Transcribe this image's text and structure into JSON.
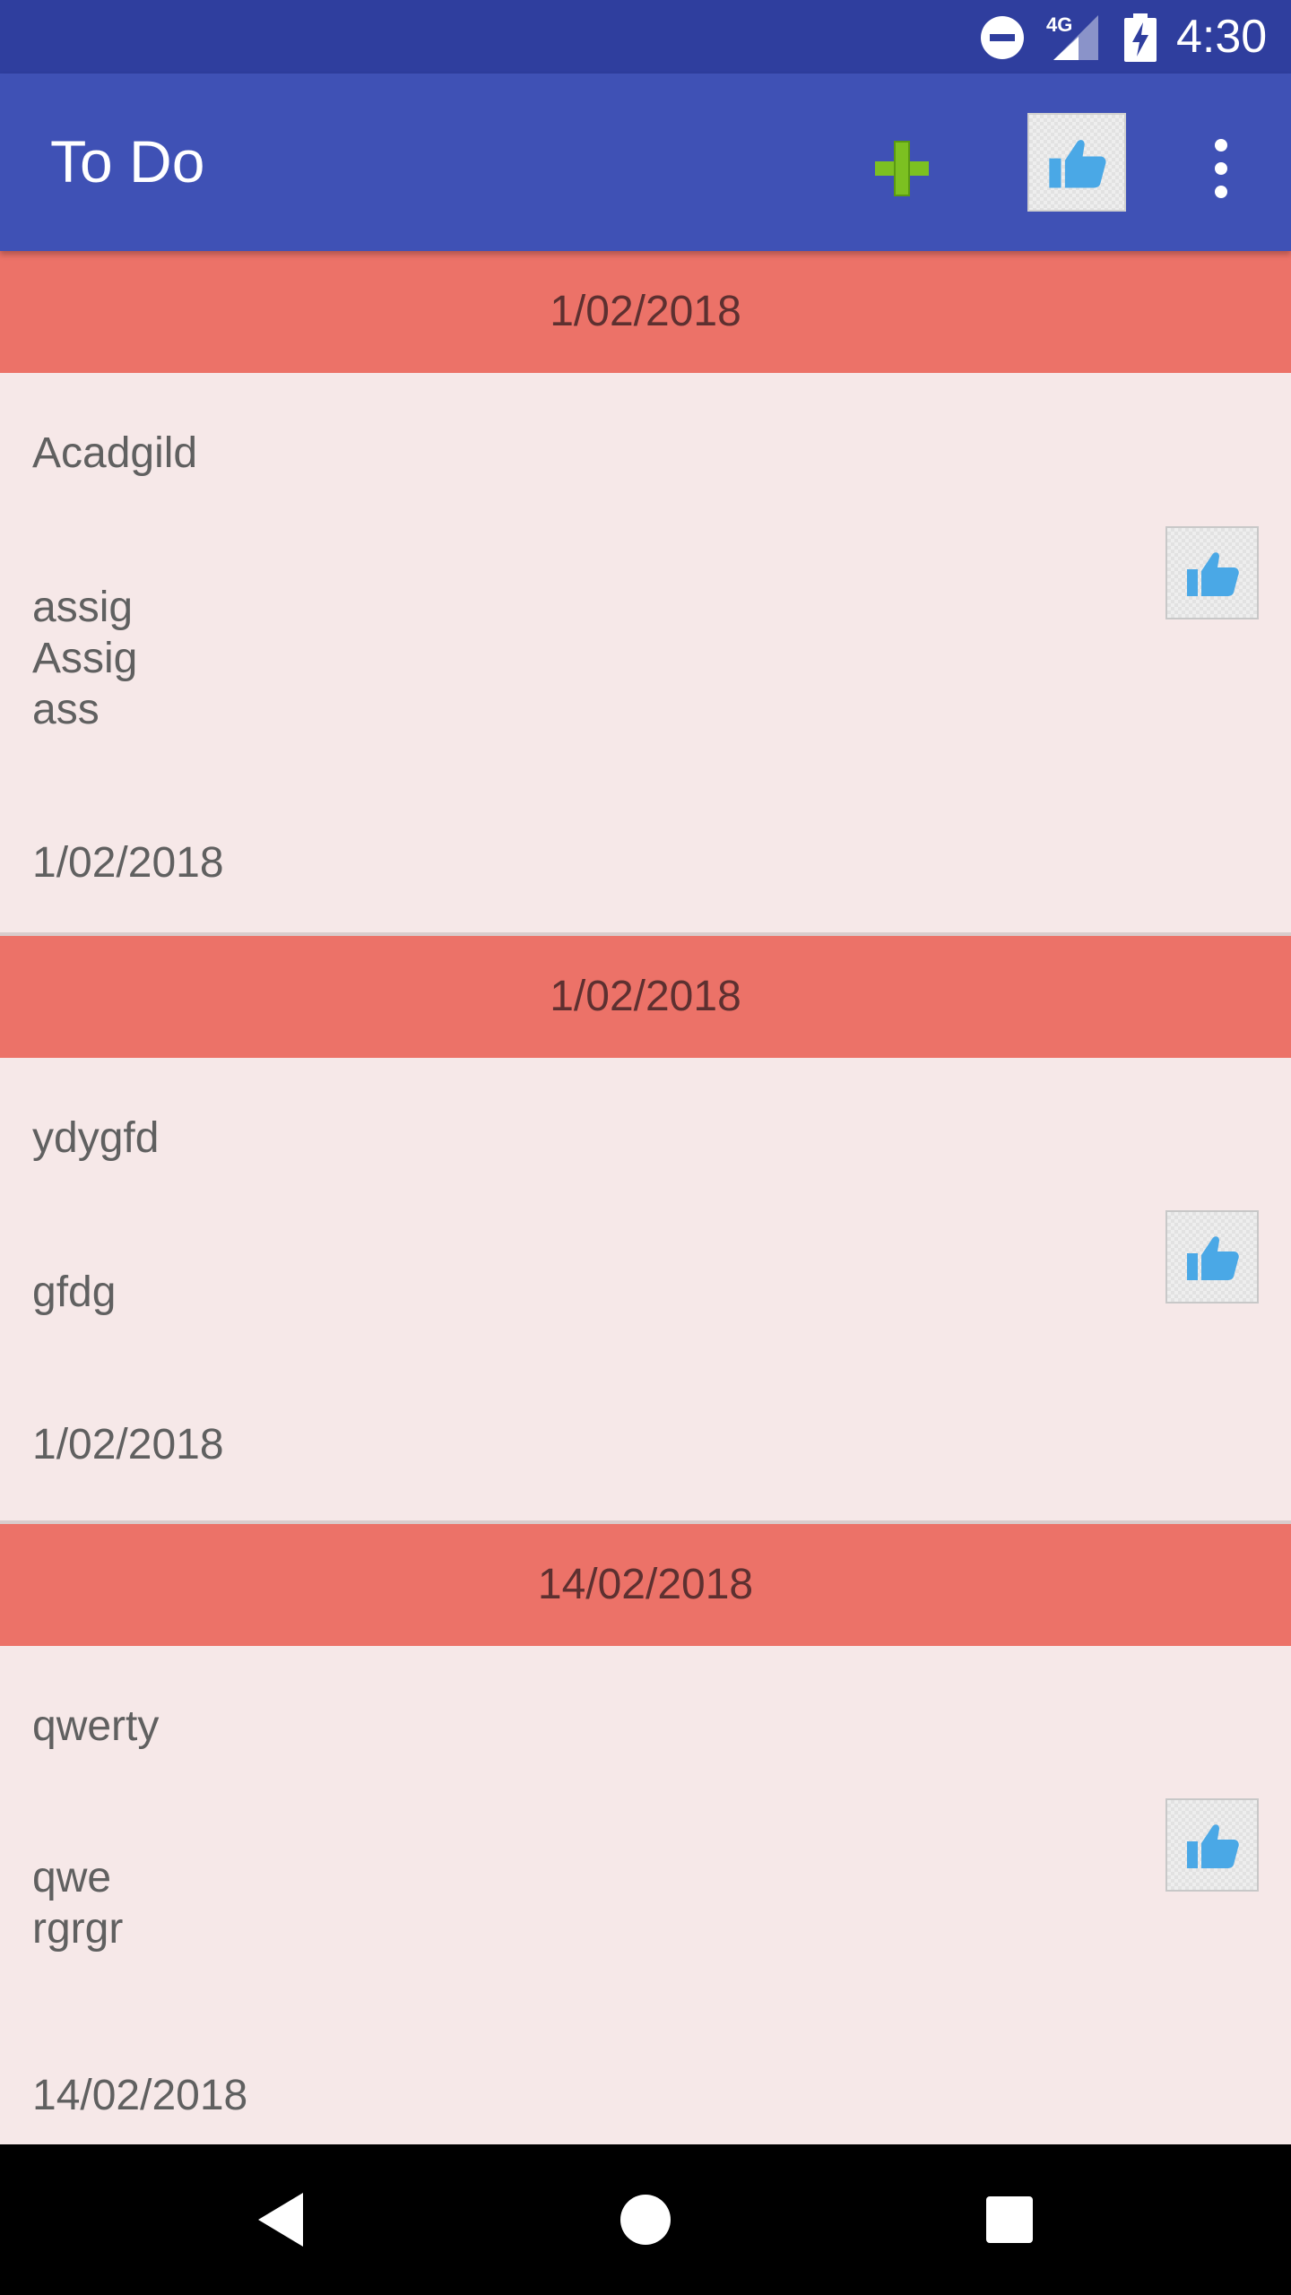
{
  "status_bar": {
    "time": "4:30",
    "network_label": "4G"
  },
  "toolbar": {
    "title": "To Do",
    "add_icon": "plus-icon",
    "like_icon": "thumbs-up-icon",
    "more_icon": "more-vert-icon"
  },
  "items": [
    {
      "header_date": "1/02/2018",
      "title": "Acadgild",
      "description": "assig\nAssig\nass",
      "date": "1/02/2018"
    },
    {
      "header_date": "1/02/2018",
      "title": "ydygfd",
      "description": "gfdg",
      "date": "1/02/2018"
    },
    {
      "header_date": "14/02/2018",
      "title": "qwerty",
      "description": "qwe\nrgrgr",
      "date": "14/02/2018"
    }
  ],
  "nav_bar": {
    "back_icon": "back-triangle-icon",
    "home_icon": "home-circle-icon",
    "recents_icon": "recents-square-icon"
  },
  "colors": {
    "status_bar": "#2f3e9e",
    "toolbar": "#3f51b5",
    "date_header": "#ec7268",
    "item_background": "#f6e8e8",
    "add_icon": "#7cc021",
    "thumbs_up": "#4aa8e6"
  }
}
